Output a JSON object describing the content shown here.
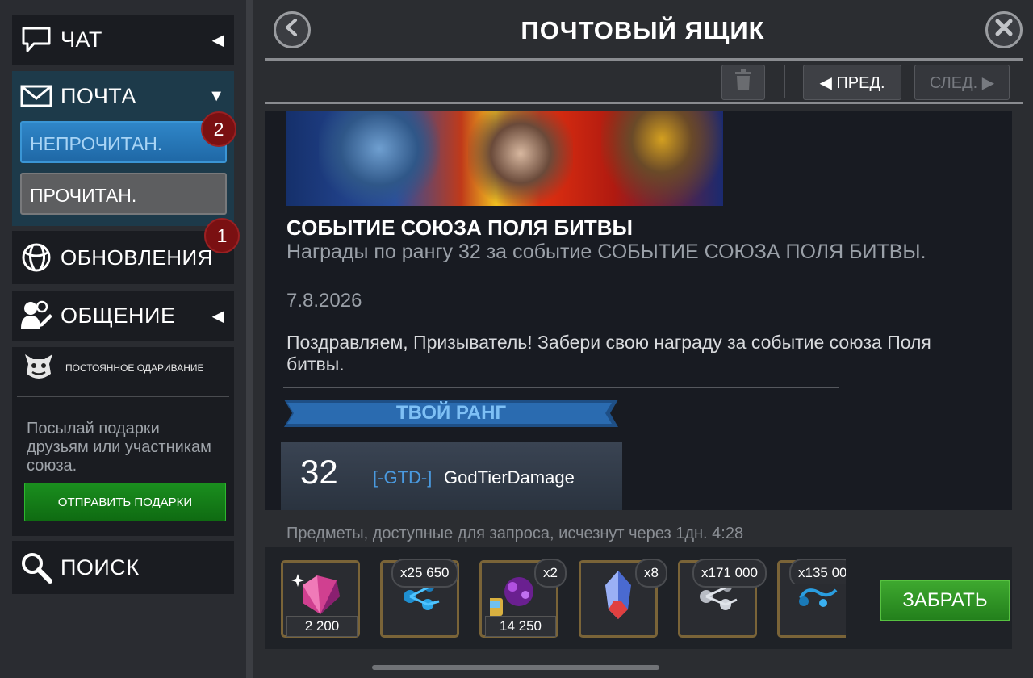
{
  "sidebar": {
    "chat": {
      "label": "ЧАТ",
      "arrow": "◀"
    },
    "mail": {
      "label": "ПОЧТА",
      "arrow": "▼",
      "unread_label": "НЕПРОЧИТАН.",
      "unread_count": "2",
      "read_label": "ПРОЧИТАН."
    },
    "updates": {
      "label": "ОБНОВЛЕНИЯ",
      "count": "1"
    },
    "social": {
      "label": "ОБЩЕНИЕ",
      "arrow": "◀"
    },
    "gifting": {
      "label": "ПОСТОЯННОЕ ОДАРИВАНИЕ",
      "text": "Посылай подарки друзьям или участникам союза.",
      "button": "ОТПРАВИТЬ ПОДАРКИ"
    },
    "search": {
      "label": "ПОИСК"
    }
  },
  "main": {
    "title": "ПОЧТОВЫЙ ЯЩИК",
    "prev_label": "◀ ПРЕД.",
    "next_label": "СЛЕД. ▶",
    "message": {
      "title": "СОБЫТИЕ СОЮЗА ПОЛЯ БИТВЫ",
      "subtitle": "Награды по рангу 32 за событие СОБЫТИЕ СОЮЗА ПОЛЯ БИТВЫ.",
      "date": "7.8.2026",
      "body": "Поздравляем, Призыватель! Забери свою награду за событие союза Поля битвы.",
      "rank_header": "ТВОЙ РАНГ",
      "rank": "32",
      "alliance_tag": "[-GTD-]",
      "player": "GodTierDamage"
    },
    "expire_text": "Предметы, доступные для запроса, исчезнут через 1дн. 4:28",
    "rewards": [
      {
        "icon": "crystal-shard-icon",
        "bottom_qty": "2 200"
      },
      {
        "icon": "blue-catalyst-icon",
        "top_qty": "x25 650"
      },
      {
        "icon": "purple-crystal-cluster-icon",
        "top_qty": "x2",
        "bottom_qty": "14 250"
      },
      {
        "icon": "crystal-icon",
        "top_qty": "x8"
      },
      {
        "icon": "silver-catalyst-icon",
        "top_qty": "x171 000"
      },
      {
        "icon": "blue-shard-icon",
        "top_qty": "x135 00"
      }
    ],
    "claim_label": "ЗАБРАТЬ"
  },
  "colors": {
    "accent_blue": "#2f86c8",
    "badge_red": "#7a1012",
    "claim_green": "#3ea82f",
    "gift_green": "#1a8e1e"
  }
}
